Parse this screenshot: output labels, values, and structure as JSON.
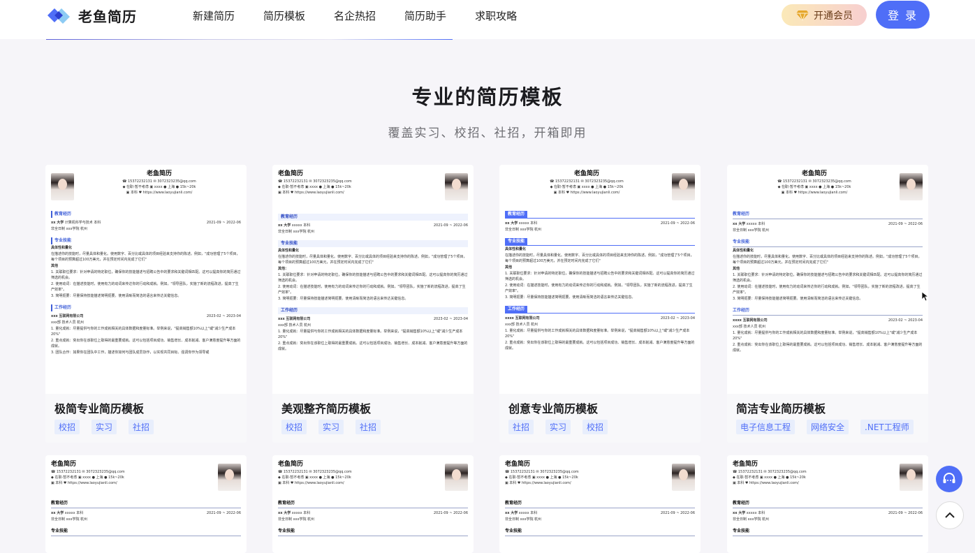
{
  "header": {
    "brand": "老鱼简历",
    "nav": [
      "新建简历",
      "简历模板",
      "名企热招",
      "简历助手",
      "求职攻略"
    ],
    "vip_label": "开通会员",
    "login_label": "登 录"
  },
  "section": {
    "title": "专业的简历模板",
    "subtitle": "覆盖实习、校招、社招，开箱即用"
  },
  "resume": {
    "name": "老鱼简历",
    "phone": "15372232131",
    "email": "3072323235@qq.com",
    "status": "在职-暂不考虑",
    "tag_xxxx": "xxxx",
    "city": "上海",
    "salary": "15k~20k",
    "degree": "本科",
    "site": "https://www.laoyujianli.com/",
    "edu_title": "教育经历",
    "school": "xx 大学",
    "major": "计算机科学与技术",
    "major_short": "xxxxx",
    "deg": "本科",
    "edu_date": "2021-09 ~ 2022-06",
    "edu_line2": "非全日制    xxx学院    杭州",
    "skill_title": "专业技能",
    "skill_h1": "具体性和量化",
    "skill_p1": "在描述你的技能时，尽量具体和量化。使用数字、百分比或具体的项目经验来支持你的陈述。例如，\"成功管理了5个项目，每个项目的预算超过100万美元，并在预定时间内完成了它们\"",
    "skill_h2": "其他",
    "skill_h2b": "其他：",
    "skill_l1": "1. 关联职位要求：针对申请的特定职位，确保你的技能描述与招聘公告中的要求和关键词相匹配。这可以提高你的简历通过筛选的机会。",
    "skill_l2": "2. 使用动词：在描述技能时，使用有力的动词来传达你的行动和成就。例如，\"领导团队，实施了新的流程改进，提高了生产效率\"。",
    "skill_l3": "3. 简明扼要：尽量保持技能描述简明扼要。使用清晰而简洁的语言来传达关键信息。",
    "work_title": "工作经历",
    "company": "xxx 互联网有限公司",
    "company_b": "xxxx 互联网有限公司",
    "work_date": "2023-02 ~ 2023-04",
    "work_line2": "xxx部  技术人员  杭州",
    "work_l1": "1. 量化成就：尽量提供与你的工作成就相关的具体数据和度量标准。举例来说，\"提高销售额10%以上\"或\"减少生产成本20%\"",
    "work_l2": "2. 重点成就：突出你在该职位上取得的最重要成就。这可以包括项目成功、销售增长、成本削减、客户满意度提升等方面的成就。",
    "work_l3": "3. 团队合作：如果你在团队中工作，描述你如何与团队成员协作，以实现共同目标。强调你作为领导或"
  },
  "cards": [
    {
      "title": "极简专业简历模板",
      "tags": [
        "校招",
        "实习",
        "社招"
      ]
    },
    {
      "title": "美观整齐简历模板",
      "tags": [
        "校招",
        "实习",
        "社招"
      ]
    },
    {
      "title": "创意专业简历模板",
      "tags": [
        "社招",
        "实习",
        "校招"
      ]
    },
    {
      "title": "简洁专业简历模板",
      "tags": [
        "电子信息工程",
        "网络安全",
        ".NET工程师"
      ]
    }
  ],
  "colors": {
    "accent": "#4f6ef7",
    "page_bg": "#f6f5f9",
    "tag_bg": "#e8eefc"
  },
  "icons": [
    "logo-icon",
    "diamond-icon",
    "headset-icon",
    "chevron-up-icon"
  ]
}
